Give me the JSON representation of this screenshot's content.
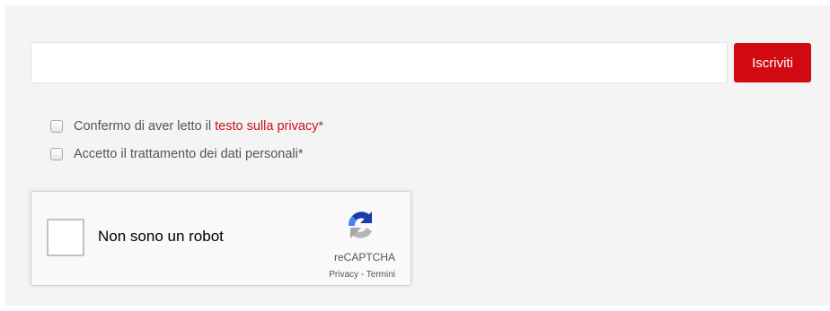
{
  "form": {
    "email_value": "",
    "subscribe_label": "Iscriviti"
  },
  "consents": [
    {
      "text_before": "Confermo di aver letto il ",
      "link_text": "testo sulla privacy",
      "suffix": "*"
    },
    {
      "text": "Accetto il trattamento dei dati personali*"
    }
  ],
  "recaptcha": {
    "label": "Non sono un robot",
    "brand": "reCAPTCHA",
    "privacy_link": "Privacy",
    "separator": " - ",
    "terms_link": "Termini",
    "icon": "recaptcha-logo-icon"
  },
  "colors": {
    "accent": "#d10a11",
    "panel_background": "#f4f4f4",
    "link": "#c8101a"
  }
}
